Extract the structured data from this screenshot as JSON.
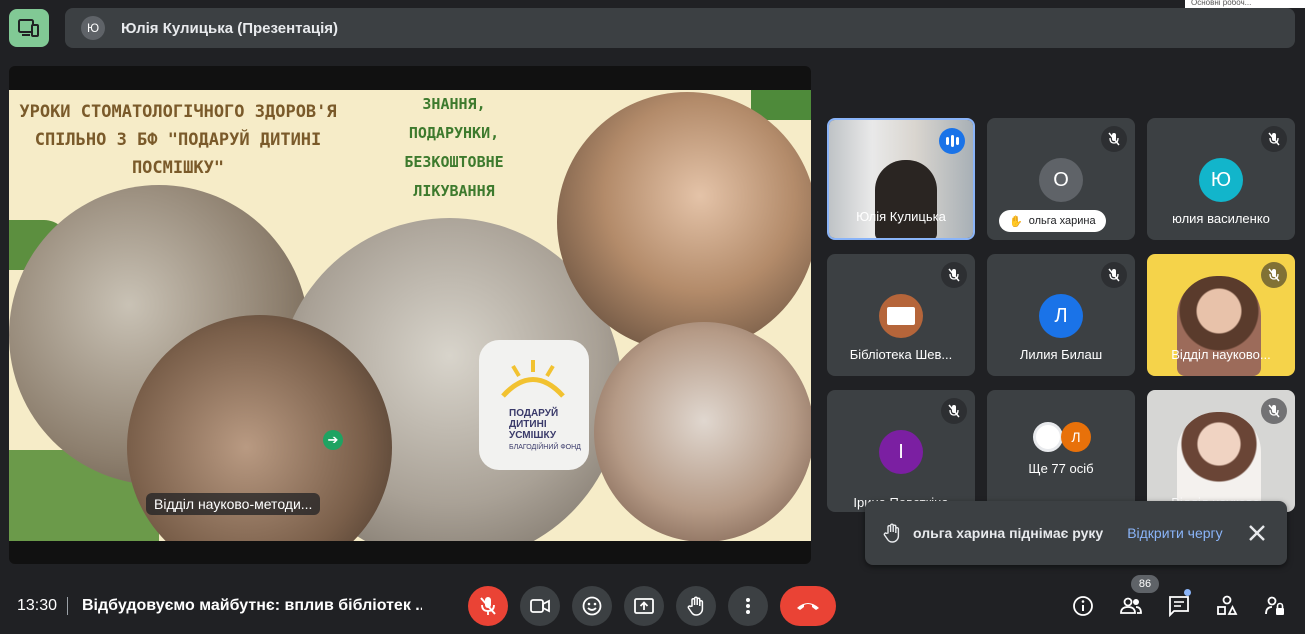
{
  "top_note": "Основні робоч...",
  "presenter": {
    "initial": "Ю",
    "label": "Юлія Кулицька (Презентація)"
  },
  "slide": {
    "title": "УРОКИ СТОМАТОЛОГІЧНОГО ЗДОРОВ'Я СПІЛЬНО З БФ \"ПОДАРУЙ ДИТИНІ ПОСМІШКУ\"",
    "subtitle": "ЗНАННЯ, ПОДАРУНКИ, БЕЗКОШТОВНЕ ЛІКУВАННЯ",
    "shirt_text": "ПОДАРУЙ ДИТИНІ УСМІШКУ",
    "shirt_sub": "БЛАГОДІЙНИЙ ФОНД"
  },
  "presenting_label": "Відділ науково-методи...",
  "tiles": [
    {
      "name": "Юлія Кулицька",
      "kind": "video",
      "speaking": true
    },
    {
      "name": "ольга харина",
      "initial": "О",
      "avatar_color": "#5f6368",
      "hand": true
    },
    {
      "name": "юлия василенко",
      "initial": "Ю",
      "avatar_color": "#12b5cb"
    },
    {
      "name": "Бібліотека Шев...",
      "kind": "logo"
    },
    {
      "name": "Лилия Билаш",
      "initial": "Л",
      "avatar_color": "#1a73e8"
    },
    {
      "name": "Відділ науково...",
      "kind": "video"
    },
    {
      "name": "Ірина Повєткіна",
      "initial": "І",
      "avatar_color": "#7b1fa2"
    },
    {
      "name": "Ще 77 осіб",
      "initial": "Л",
      "avatar_color": "#e8710a"
    },
    {
      "name": "Відділ науково...",
      "kind": "video"
    }
  ],
  "toast": {
    "message": "ольга харина піднімає руку",
    "action": "Відкрити чергу"
  },
  "bottom": {
    "time": "13:30",
    "meeting_title": "Відбудовуємо майбутнє: вплив бібліотек ...",
    "participants_count": "86"
  }
}
